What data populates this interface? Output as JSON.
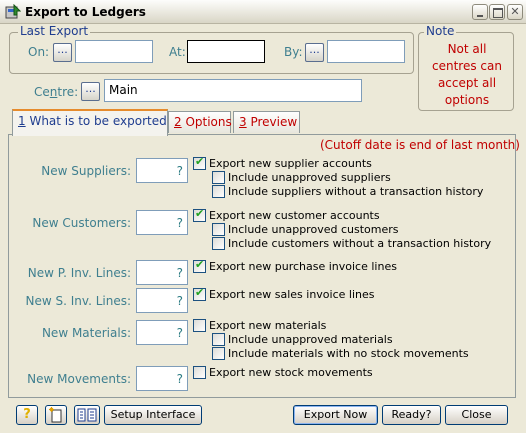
{
  "window": {
    "title": "Export to Ledgers"
  },
  "last_export": {
    "legend": "Last Export",
    "on_label": "On:",
    "on_value": "",
    "dots": "...",
    "at_label": "At:",
    "at_value": "",
    "by_label": "By:",
    "by_value": ""
  },
  "note": {
    "legend": "Note",
    "text_lines": [
      "Not all",
      "centres can",
      "accept all",
      "options"
    ]
  },
  "centre": {
    "label_pre": "Ce",
    "label_ul": "n",
    "label_post": "tre:",
    "value": "Main"
  },
  "tabs": [
    {
      "num": "1",
      "label": " What is to be exported"
    },
    {
      "num": "2",
      "label": " Options"
    },
    {
      "num": "3",
      "label": " Preview"
    }
  ],
  "cutoff_text": "(Cutoff date is end of last month)",
  "rows": [
    {
      "label": "New Suppliers:",
      "q": "?",
      "options": [
        {
          "label": "Export new supplier accounts",
          "checked": true
        },
        {
          "label": "Include unapproved suppliers",
          "checked": false
        },
        {
          "label": "Include suppliers without a transaction history",
          "checked": false
        }
      ]
    },
    {
      "label": "New Customers:",
      "q": "?",
      "options": [
        {
          "label": "Export new customer accounts",
          "checked": true
        },
        {
          "label": "Include unapproved customers",
          "checked": false
        },
        {
          "label": "Include customers without a transaction history",
          "checked": false
        }
      ]
    },
    {
      "label": "New P. Inv. Lines:",
      "q": "?",
      "options": [
        {
          "label": "Export new purchase invoice lines",
          "checked": true
        }
      ]
    },
    {
      "label": "New S. Inv. Lines:",
      "q": "?",
      "options": [
        {
          "label": "Export new sales invoice lines",
          "checked": true
        }
      ]
    },
    {
      "label": "New Materials:",
      "q": "?",
      "options": [
        {
          "label": "Export new materials",
          "checked": false
        },
        {
          "label": "Include unapproved materials",
          "checked": false
        },
        {
          "label": "Include materials with no stock movements",
          "checked": false
        }
      ]
    },
    {
      "label": "New Movements:",
      "q": "?",
      "options": [
        {
          "label": "Export new stock movements",
          "checked": false
        }
      ]
    }
  ],
  "bottom": {
    "help_icon": "question-icon",
    "new_icon": "new-document-icon",
    "layout_icon": "layout-icon",
    "setup_label": "Setup Interface",
    "export_label": "Export Now",
    "ready_label": "Ready?",
    "close_label": "Close"
  }
}
